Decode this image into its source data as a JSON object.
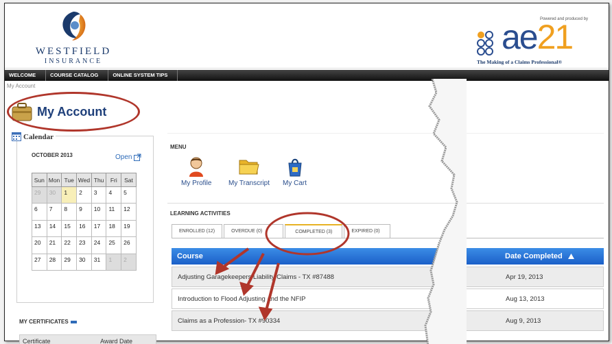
{
  "header": {
    "brand_name": "WESTFIELD",
    "brand_sub": "INSURANCE",
    "powered_by": "Powered and produced by",
    "ae_logo_main": "ae",
    "ae_logo_num": "21",
    "ae_tagline": "The Making of a Claims Professional®"
  },
  "nav": {
    "items": [
      "WELCOME",
      "COURSE CATALOG",
      "ONLINE SYSTEM TIPS"
    ]
  },
  "breadcrumb": "My Account",
  "page_title": "My Account",
  "calendar": {
    "heading": "Calendar",
    "month": "OCTOBER 2013",
    "open_label": "Open",
    "days": [
      "Sun",
      "Mon",
      "Tue",
      "Wed",
      "Thu",
      "Fri",
      "Sat"
    ],
    "weeks": [
      [
        "29",
        "30",
        "1",
        "2",
        "3",
        "4",
        "5"
      ],
      [
        "6",
        "7",
        "8",
        "9",
        "10",
        "11",
        "12"
      ],
      [
        "13",
        "14",
        "15",
        "16",
        "17",
        "18",
        "19"
      ],
      [
        "20",
        "21",
        "22",
        "23",
        "24",
        "25",
        "26"
      ],
      [
        "27",
        "28",
        "29",
        "30",
        "31",
        "1",
        "2"
      ]
    ]
  },
  "certificates": {
    "heading": "MY CERTIFICATES",
    "col_certificate": "Certificate",
    "col_award_date": "Award Date"
  },
  "menu": {
    "heading": "MENU",
    "items": [
      "My Profile",
      "My Transcript",
      "My Cart"
    ]
  },
  "learning": {
    "heading": "LEARNING ACTIVITIES",
    "tabs": [
      "ENROLLED (12)",
      "OVERDUE (0)",
      "COMPLETED (3)",
      "EXPIRED (0)"
    ],
    "columns": {
      "course": "Course",
      "date": "Date Completed"
    },
    "rows": [
      {
        "course": "Adjusting Garagekeepers Liability Claims - TX #87488",
        "date": "Apr 19, 2013"
      },
      {
        "course": "Introduction to Flood Adjusting and the NFIP",
        "date": "Aug 13, 2013"
      },
      {
        "course": "Claims as a Profession- TX #90334",
        "date": "Aug 9, 2013"
      }
    ]
  },
  "colors": {
    "accent_blue": "#1b5fc8",
    "annotation_red": "#b0362b",
    "tab_active": "#e7b123"
  }
}
